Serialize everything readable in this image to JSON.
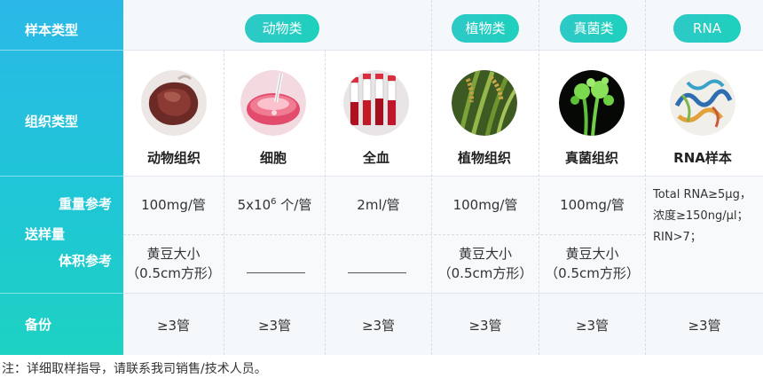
{
  "header_col": {
    "sample_type": "样本类型",
    "tissue_type": "组织类型",
    "weight_ref": "重量参考",
    "sending_amount": "送样量",
    "volume_ref": "体积参考",
    "backup": "备份"
  },
  "categories": {
    "animal": "动物类",
    "plant": "植物类",
    "fungi": "真菌类",
    "rna": "RNA"
  },
  "tissues": [
    {
      "label": "动物组织",
      "icon": "animal-tissue-image"
    },
    {
      "label": "细胞",
      "icon": "cells-image"
    },
    {
      "label": "全血",
      "icon": "whole-blood-image"
    },
    {
      "label": "植物组织",
      "icon": "plant-tissue-image"
    },
    {
      "label": "真菌组织",
      "icon": "fungi-tissue-image"
    },
    {
      "label": "RNA样本",
      "icon": "rna-sample-image"
    }
  ],
  "weights": {
    "animal": "100mg/管",
    "cells_base": "5x10",
    "cells_exp": "6",
    "cells_unit": " 个/管",
    "blood": "2ml/管",
    "plant": "100mg/管",
    "fungi": "100mg/管"
  },
  "volumes": {
    "animal_l1": "黄豆大小",
    "animal_l2": "（0.5cm方形）",
    "plant_l1": "黄豆大小",
    "plant_l2": "（0.5cm方形）",
    "fungi_l1": "黄豆大小",
    "fungi_l2": "（0.5cm方形）"
  },
  "rna_note": {
    "line1": "Total RNA≥5μg，",
    "line2": "浓度≥150ng/μl；",
    "line3": "RIN>7；"
  },
  "backup": [
    "≥3管",
    "≥3管",
    "≥3管",
    "≥3管",
    "≥3管",
    "≥3管"
  ],
  "footnote": "注：详细取样指导，请联系我司销售/技术人员。",
  "colors": {
    "gradient_top": "#2bb8e8",
    "gradient_bottom": "#1dd2c2",
    "pill": "#22cdc2"
  }
}
